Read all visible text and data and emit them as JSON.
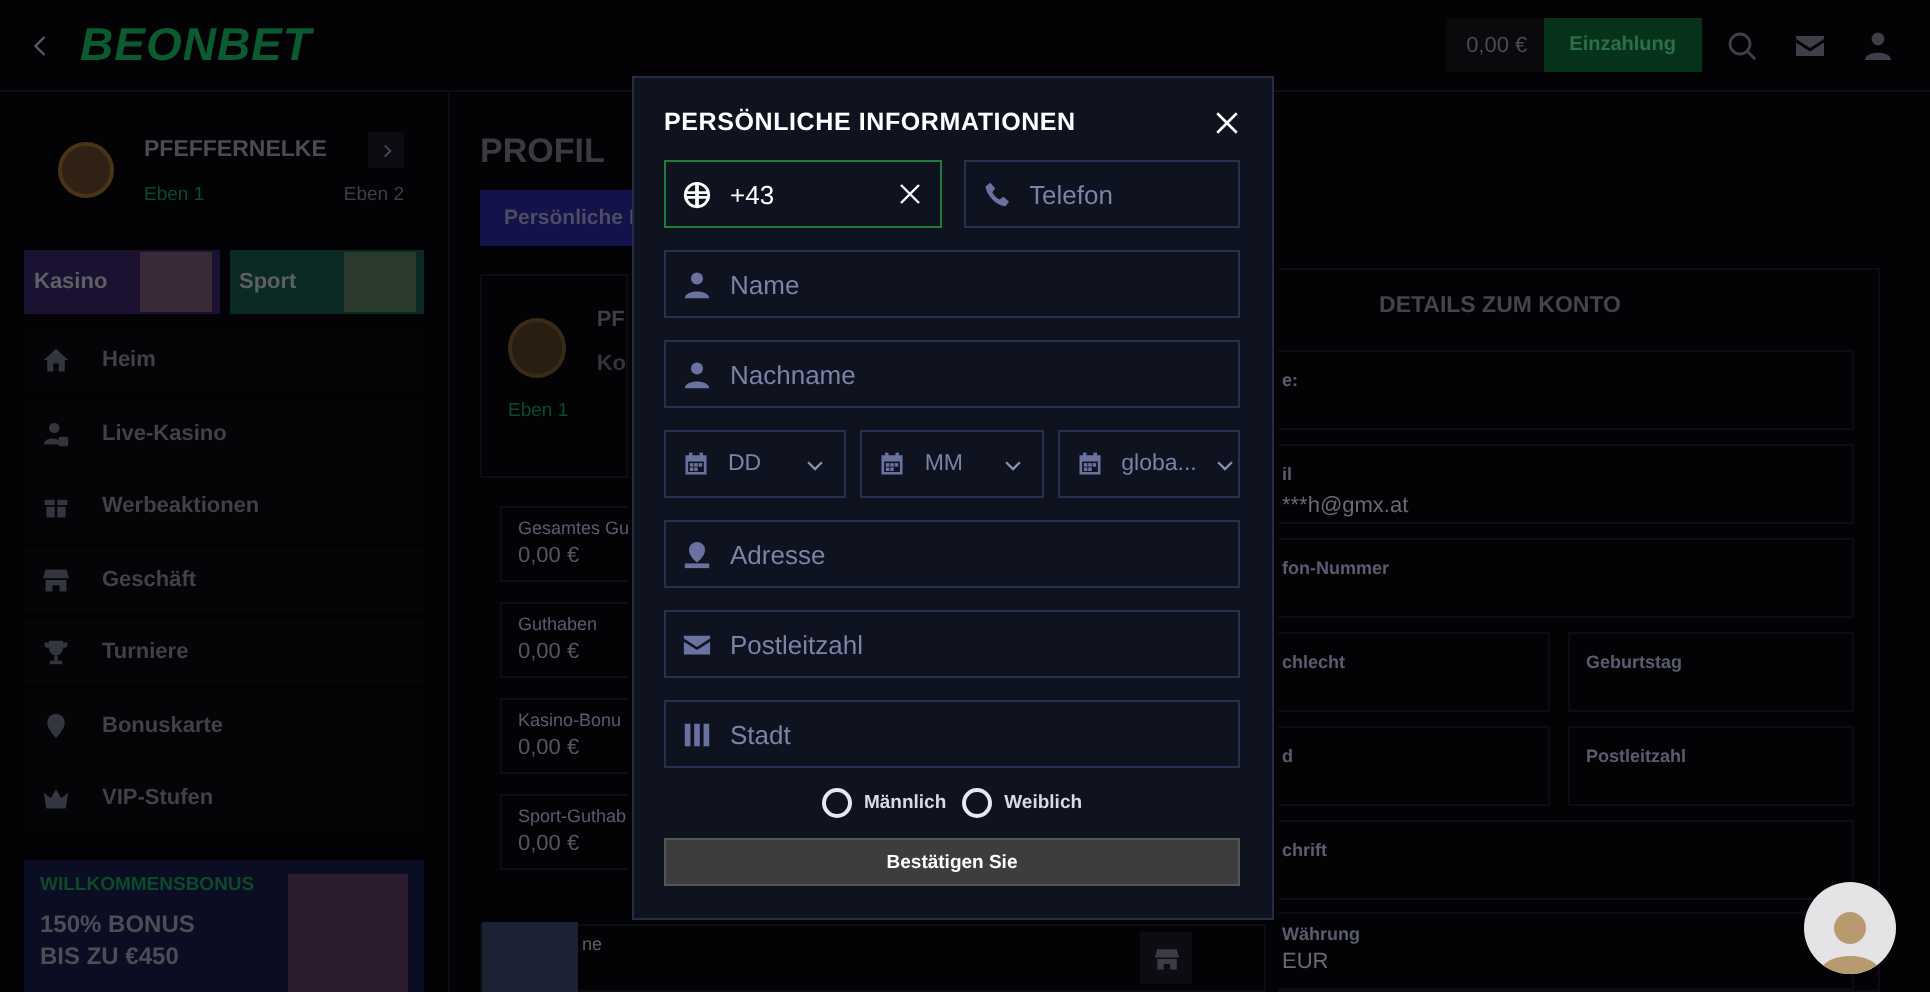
{
  "header": {
    "logo": "BEONBET",
    "balance": "0,00 €",
    "deposit": "Einzahlung"
  },
  "sidebar": {
    "username": "PFEFFERNELKE",
    "level_current": "Eben 1",
    "level_next": "Eben 2",
    "categories": [
      {
        "label": "Kasino",
        "kind": "casino"
      },
      {
        "label": "Sport",
        "kind": "sport"
      }
    ],
    "nav": [
      {
        "label": "Heim"
      },
      {
        "label": "Live-Kasino"
      },
      {
        "label": "Werbeaktionen"
      },
      {
        "label": "Geschäft"
      },
      {
        "label": "Turniere"
      },
      {
        "label": "Bonuskarte"
      },
      {
        "label": "VIP-Stufen"
      }
    ],
    "banner": {
      "eyebrow": "WILLKOMMENSBONUS",
      "lines": [
        "150% BONUS",
        "BIS ZU €450"
      ]
    }
  },
  "profile": {
    "title": "PROFIL",
    "tab": "Persönliche I",
    "card": {
      "name": "PF",
      "subtitle": "Ko",
      "level": "Eben 1"
    },
    "balances": [
      {
        "label": "Gesamtes Gu",
        "value": "0,00 €"
      },
      {
        "label": "Guthaben",
        "value": "0,00 €"
      },
      {
        "label": "Kasino-Bonu",
        "value": "0,00 €"
      },
      {
        "label": "Sport-Guthab",
        "value": "0,00 €"
      },
      {
        "label": "ne"
      }
    ]
  },
  "account_details": {
    "title": "DETAILS ZUM KONTO",
    "rows": [
      [
        {
          "label": "e:"
        }
      ],
      [
        {
          "label": "il",
          "value": "***h@gmx.at"
        }
      ],
      [
        {
          "label": "fon-Nummer"
        }
      ],
      [
        {
          "label": "chlecht"
        },
        {
          "label": "Geburtstag"
        }
      ],
      [
        {
          "label": "d"
        },
        {
          "label": "Postleitzahl"
        }
      ],
      [
        {
          "label": "chrift"
        }
      ]
    ],
    "currency": {
      "label": "Währung",
      "value": "EUR"
    }
  },
  "modal": {
    "title": "PERSÖNLICHE INFORMATIONEN",
    "phone_row": [
      {
        "kind": "country",
        "value": "+43",
        "focused": true
      },
      {
        "kind": "phone",
        "placeholder": "Telefon",
        "focused": false
      }
    ],
    "fields_top": [
      {
        "placeholder": "Name"
      },
      {
        "placeholder": "Nachname"
      }
    ],
    "birth_date": [
      {
        "text": "DD"
      },
      {
        "text": "MM"
      },
      {
        "text": "globa..."
      }
    ],
    "fields_bottom": [
      {
        "placeholder": "Adresse"
      },
      {
        "placeholder": "Postleitzahl"
      },
      {
        "placeholder": "Stadt"
      }
    ],
    "gender": [
      {
        "label": "Männlich",
        "selected": false
      },
      {
        "label": "Weiblich",
        "selected": false
      }
    ],
    "submit": "Bestätigen Sie"
  }
}
